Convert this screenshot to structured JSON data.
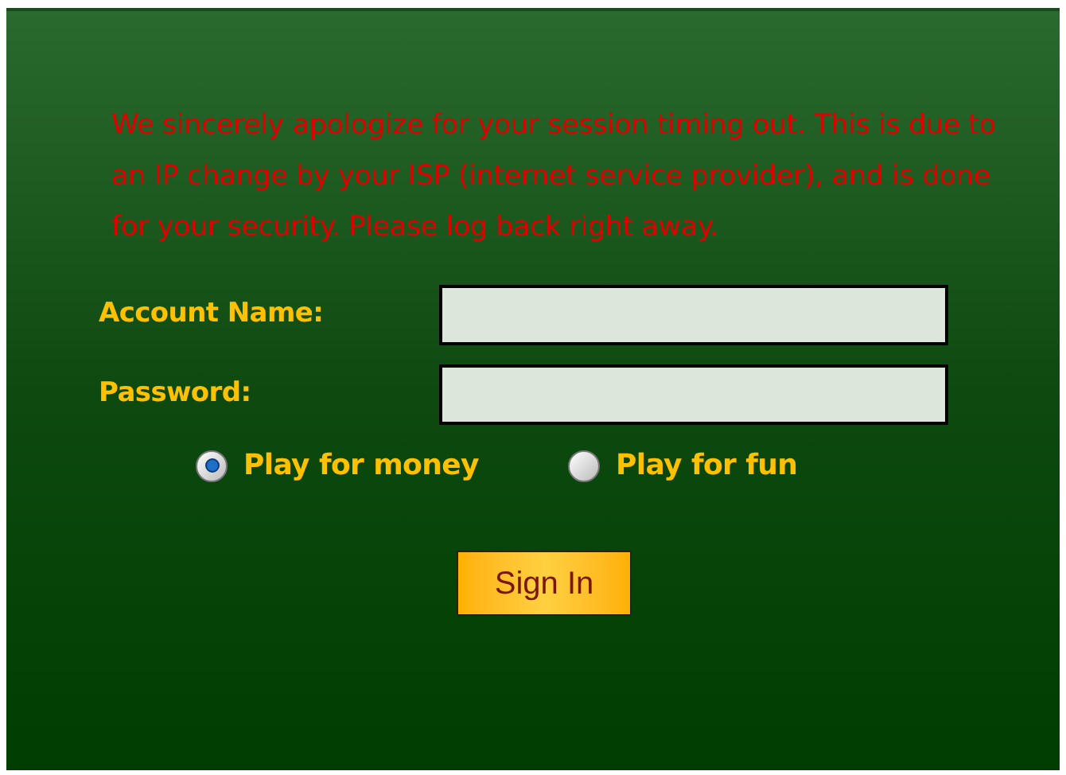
{
  "message": "We sincerely apologize for your session timing out. This is due to an IP change by your ISP (internet service provider), and is done for your security. Please log back right away.",
  "fields": [
    {
      "label": "Account Name:"
    },
    {
      "label": "Password:"
    }
  ],
  "modes": [
    {
      "label": "Play for money",
      "selected": true
    },
    {
      "label": "Play for fun",
      "selected": false
    }
  ],
  "button": "Sign In"
}
